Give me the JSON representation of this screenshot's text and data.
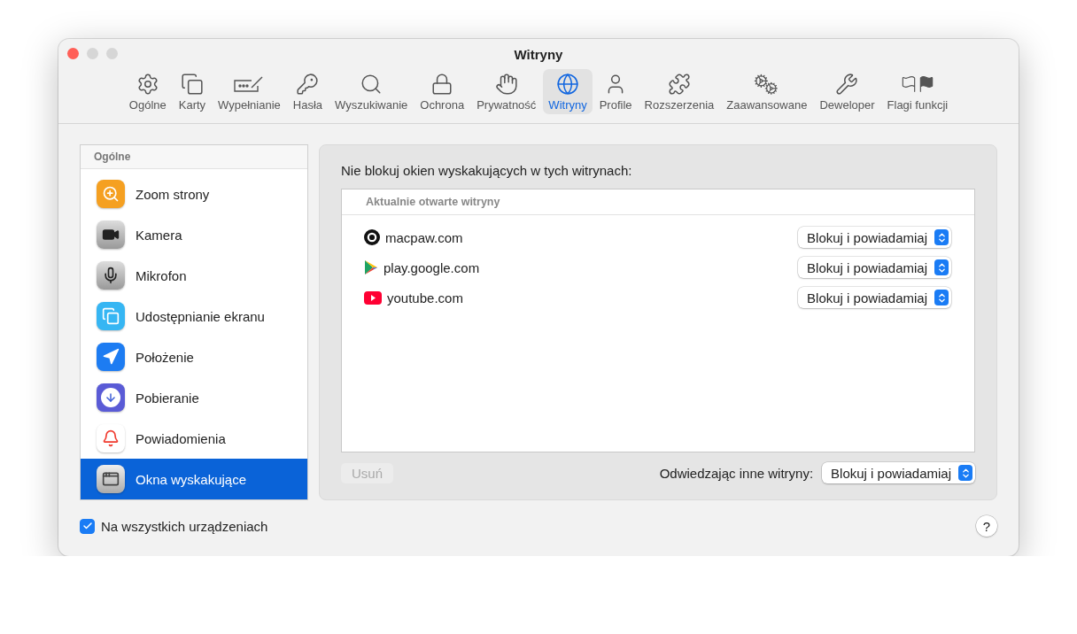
{
  "window": {
    "title": "Witryny"
  },
  "toolbar": [
    {
      "label": "Ogólne",
      "kind": "gear",
      "selected": false
    },
    {
      "label": "Karty",
      "kind": "tabs",
      "selected": false
    },
    {
      "label": "Wypełnianie",
      "kind": "autofill",
      "selected": false
    },
    {
      "label": "Hasła",
      "kind": "key",
      "selected": false
    },
    {
      "label": "Wyszukiwanie",
      "kind": "search",
      "selected": false
    },
    {
      "label": "Ochrona",
      "kind": "lock",
      "selected": false
    },
    {
      "label": "Prywatność",
      "kind": "hand",
      "selected": false
    },
    {
      "label": "Witryny",
      "kind": "globe",
      "selected": true
    },
    {
      "label": "Profile",
      "kind": "person",
      "selected": false
    },
    {
      "label": "Rozszerzenia",
      "kind": "puzzle",
      "selected": false
    },
    {
      "label": "Zaawansowane",
      "kind": "gears",
      "selected": false
    },
    {
      "label": "Deweloper",
      "kind": "tools",
      "selected": false
    },
    {
      "label": "Flagi funkcji",
      "kind": "flags",
      "selected": false
    }
  ],
  "sidebar": {
    "header": "Ogólne",
    "items": [
      {
        "label": "Zoom strony",
        "kind": "zoom",
        "selected": false
      },
      {
        "label": "Kamera",
        "kind": "camera",
        "selected": false
      },
      {
        "label": "Mikrofon",
        "kind": "mic",
        "selected": false
      },
      {
        "label": "Udostępnianie ekranu",
        "kind": "screen",
        "selected": false
      },
      {
        "label": "Położenie",
        "kind": "location",
        "selected": false
      },
      {
        "label": "Pobieranie",
        "kind": "download",
        "selected": false
      },
      {
        "label": "Powiadomienia",
        "kind": "bell",
        "selected": false
      },
      {
        "label": "Okna wyskakujące",
        "kind": "popup",
        "selected": true
      }
    ]
  },
  "panel": {
    "heading": "Nie blokuj okien wyskakujących w tych witrynach:",
    "list_header": "Aktualnie otwarte witryny",
    "sites": [
      {
        "name": "macpaw.com",
        "kind": "macpaw",
        "setting": "Blokuj i powiadamiaj"
      },
      {
        "name": "play.google.com",
        "kind": "play",
        "setting": "Blokuj i powiadamiaj"
      },
      {
        "name": "youtube.com",
        "kind": "youtube",
        "setting": "Blokuj i powiadamiaj"
      }
    ],
    "remove_button": {
      "label": "Usuń",
      "disabled": true
    },
    "other_label": "Odwiedzając inne witryny:",
    "other_setting": "Blokuj i powiadamiaj"
  },
  "footer": {
    "checkbox": {
      "label": "Na wszystkich urządzeniach",
      "checked": true
    },
    "help": "?"
  }
}
